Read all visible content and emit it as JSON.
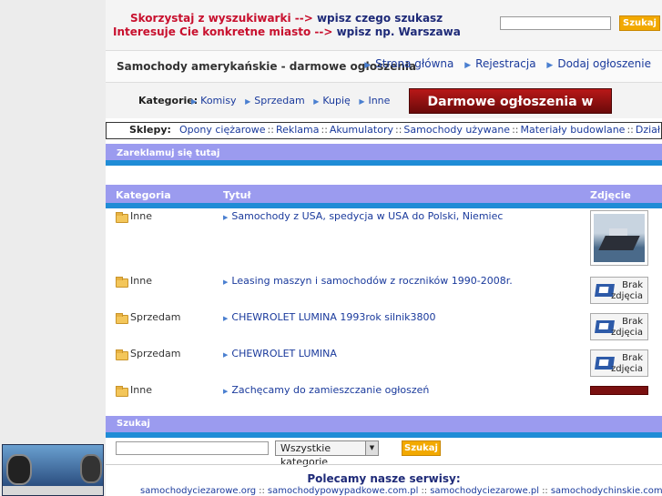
{
  "promo": {
    "line1_red": "Skorzystaj z wyszukiwarki -->",
    "line1_navy": "wpisz czego szukasz",
    "line2_red": "Interesuje Cie konkretne miasto -->",
    "line2_navy": "wpisz np. Warszawa"
  },
  "top_search": {
    "button": "Szukaj",
    "value": ""
  },
  "header": {
    "title": "Samochody amerykańskie - darmowe ogłoszenia",
    "nav": [
      "Strona główna",
      "Rejestracja",
      "Dodaj ogłoszenie"
    ]
  },
  "categories": {
    "label": "Kategorie:",
    "items": [
      "Komisy",
      "Sprzedam",
      "Kupię",
      "Inne"
    ],
    "banner": "Darmowe ogłoszenia w sieci !!"
  },
  "shops": {
    "label": "Sklepy:",
    "items": [
      "Opony ciężarowe",
      "Reklama",
      "Akumulatory",
      "Samochody używane",
      "Materiały budowlane",
      "Działki budowlane"
    ]
  },
  "ad_bar": {
    "label": "Zareklamuj się tutaj"
  },
  "table": {
    "headers": [
      "Kategoria",
      "Tytuł",
      "Zdjęcie"
    ],
    "rows": [
      {
        "category": "Inne",
        "title": "Samochody z USA, spedycja w USA do Polski, Niemiec",
        "photo": "ship-image"
      },
      {
        "category": "Inne",
        "title": "Leasing maszyn i samochodów z roczników 1990-2008r.",
        "photo": "no-photo"
      },
      {
        "category": "Sprzedam",
        "title": "CHEWROLET LUMINA 1993rok silnik3800",
        "photo": "no-photo"
      },
      {
        "category": "Sprzedam",
        "title": "CHEWROLET LUMINA",
        "photo": "no-photo"
      },
      {
        "category": "Inne",
        "title": "Zachęcamy do zamieszczanie ogłoszeń",
        "photo": "ad-banner"
      }
    ],
    "no_photo_line1": "Brak",
    "no_photo_line2": "zdjęcia"
  },
  "search_bar": {
    "label": "Szukaj",
    "input_value": "",
    "select_value": "Wszystkie kategorie",
    "button": "Szukaj"
  },
  "footer": {
    "title": "Polecamy nasze serwisy:",
    "links": [
      "samochodyciezarowe.org",
      "samochodypowypadkowe.com.pl",
      "samochodyciezarowe.pl",
      "samochodychinskie.com"
    ]
  },
  "colors": {
    "header_bar": "#9b9bef",
    "stripe": "#1f8cd6",
    "button": "#f2a900",
    "link": "#1a3a9c",
    "promo_red": "#c8102e",
    "promo_navy": "#1e2a78"
  }
}
